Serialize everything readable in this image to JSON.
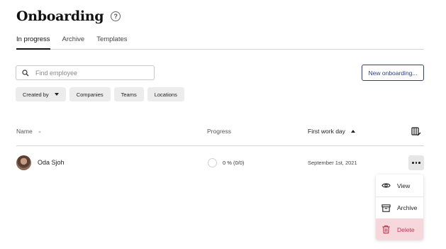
{
  "page": {
    "title": "Onboarding"
  },
  "tabs": [
    {
      "label": "In progress",
      "active": true
    },
    {
      "label": "Archive",
      "active": false
    },
    {
      "label": "Templates",
      "active": false
    }
  ],
  "search": {
    "placeholder": "Find employee",
    "value": ""
  },
  "actions": {
    "new_label": "New onboarding..."
  },
  "filters": [
    {
      "label": "Created by",
      "has_dropdown": true
    },
    {
      "label": "Companies"
    },
    {
      "label": "Teams"
    },
    {
      "label": "Locations"
    }
  ],
  "table": {
    "columns": {
      "name": "Name",
      "progress": "Progress",
      "first_day": "First work day"
    },
    "rows": [
      {
        "name": "Oda Sjoh",
        "progress": "0 % (0/0)",
        "first_day": "September 1st, 2021"
      }
    ]
  },
  "menu": {
    "items": [
      {
        "label": "View",
        "icon": "eye-icon"
      },
      {
        "label": "Archive",
        "icon": "archive-box-icon"
      },
      {
        "label": "Delete",
        "icon": "trash-icon",
        "danger": true
      }
    ]
  },
  "colors": {
    "accent": "#2b3e8a",
    "danger": "#c2354c",
    "danger_bg": "#f5d7dc"
  }
}
